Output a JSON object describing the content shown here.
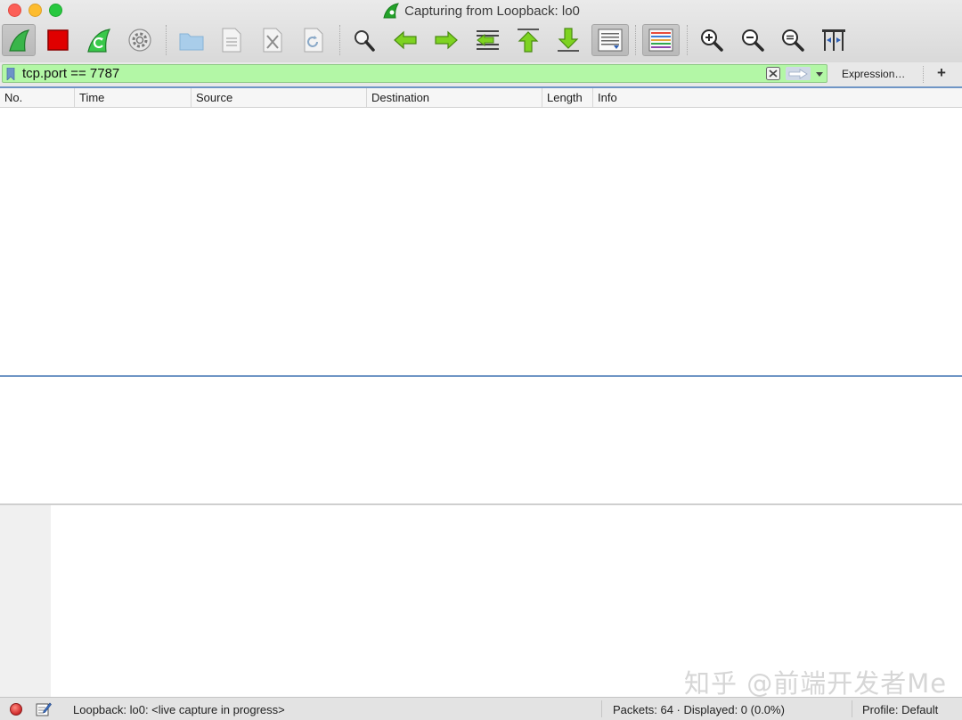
{
  "window": {
    "title": "Capturing from Loopback: lo0"
  },
  "toolbar": {
    "buttons": [
      {
        "name": "start-capture-button",
        "icon": "shark-fin-icon"
      },
      {
        "name": "stop-capture-button",
        "icon": "stop-square-icon"
      },
      {
        "name": "restart-capture-button",
        "icon": "restart-fin-icon"
      },
      {
        "name": "capture-options-button",
        "icon": "gear-icon"
      },
      {
        "name": "open-file-button",
        "icon": "folder-icon"
      },
      {
        "name": "save-file-button",
        "icon": "document-icon"
      },
      {
        "name": "close-file-button",
        "icon": "close-document-icon"
      },
      {
        "name": "reload-file-button",
        "icon": "reload-icon"
      },
      {
        "name": "find-packet-button",
        "icon": "magnifier-icon"
      },
      {
        "name": "go-back-button",
        "icon": "arrow-left-icon"
      },
      {
        "name": "go-forward-button",
        "icon": "arrow-right-icon"
      },
      {
        "name": "go-to-packet-button",
        "icon": "goto-packet-icon"
      },
      {
        "name": "first-packet-button",
        "icon": "arrow-up-bar-icon"
      },
      {
        "name": "last-packet-button",
        "icon": "arrow-down-bar-icon"
      },
      {
        "name": "auto-scroll-button",
        "icon": "auto-scroll-icon"
      },
      {
        "name": "colorize-button",
        "icon": "colorize-icon"
      },
      {
        "name": "zoom-in-button",
        "icon": "zoom-in-icon"
      },
      {
        "name": "zoom-out-button",
        "icon": "zoom-out-icon"
      },
      {
        "name": "normal-size-button",
        "icon": "zoom-reset-icon"
      },
      {
        "name": "resize-columns-button",
        "icon": "resize-columns-icon"
      }
    ]
  },
  "filter": {
    "value": "tcp.port == 7787",
    "expression_label": "Expression…",
    "add_label": "+",
    "background_color": "#b3f7a6"
  },
  "packet_list": {
    "columns": [
      "No.",
      "Time",
      "Source",
      "Destination",
      "Length",
      "Info"
    ],
    "rows": []
  },
  "status": {
    "capture_text": "Loopback: lo0: <live capture in progress>",
    "packets_text": "Packets: 64 · Displayed: 0 (0.0%)",
    "profile_text": "Profile: Default"
  },
  "watermark": {
    "text": "知乎 @前端开发者Me"
  },
  "colors": {
    "accent": "#6f95c5",
    "filter_valid": "#b3f7a6"
  }
}
